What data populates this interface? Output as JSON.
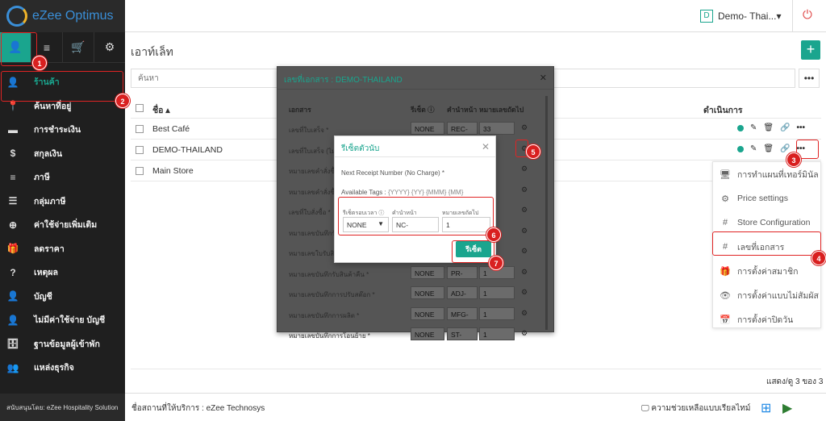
{
  "app": {
    "logo_text": "eZee Optimus"
  },
  "sidebar": {
    "tabs": [
      {
        "icon": "user-icon",
        "glyph": "👤"
      },
      {
        "icon": "menu-icon",
        "glyph": "≡"
      },
      {
        "icon": "cart-icon",
        "glyph": "🛒"
      },
      {
        "icon": "gear-icon",
        "glyph": "⚙"
      }
    ],
    "items": [
      {
        "label": "ร้านค้า",
        "glyph": "👤"
      },
      {
        "label": "ค้นหาที่อยู่",
        "glyph": "📍"
      },
      {
        "label": "การชำระเงิน",
        "glyph": "▬"
      },
      {
        "label": "สกุลเงิน",
        "glyph": "$"
      },
      {
        "label": "ภาษี",
        "glyph": "≡"
      },
      {
        "label": "กลุ่มภาษี",
        "glyph": "☰"
      },
      {
        "label": "ค่าใช้จ่ายเพิ่มเติม",
        "glyph": "⊕"
      },
      {
        "label": "ลดราคา",
        "glyph": "🎁"
      },
      {
        "label": "เหตุผล",
        "glyph": "?"
      },
      {
        "label": "บัญชี",
        "glyph": "👤"
      },
      {
        "label": "ไม่มีค่าใช้จ่าย บัญชี",
        "glyph": "👤"
      },
      {
        "label": "ฐานข้อมูลผู้เข้าพัก",
        "glyph": "🗄"
      },
      {
        "label": "แหล่งธุรกิจ",
        "glyph": "👥"
      }
    ],
    "footer": "สนับสนุนโดย: eZee Hospitality Solution"
  },
  "header": {
    "property_badge": "D",
    "property_name": "Demo- Thai...▾"
  },
  "page": {
    "title": "เอาท์เล็ท",
    "add_label": "+",
    "search_placeholder": "ค้นหา",
    "more_label": "•••",
    "table": {
      "col_name": "ชื่อ ▴",
      "col_actions": "ดำเนินการ",
      "rows": [
        "Best Café",
        "DEMO-THAILAND",
        "Main Store"
      ]
    },
    "pager": "แสดง/ดู 3 ของ 3"
  },
  "menu": {
    "items": [
      {
        "label": "การทำแผนที่เทอร์มินัล",
        "glyph": "🖥"
      },
      {
        "label": "Price settings",
        "glyph": "⚙"
      },
      {
        "label": "Store Configuration",
        "glyph": "#"
      },
      {
        "label": "เลขที่เอกสาร",
        "glyph": "#"
      },
      {
        "label": "การตั้งค่าสมาชิก",
        "glyph": "🎁"
      },
      {
        "label": "การตั้งค่าแบบไม่สัมผัส",
        "glyph": "👁"
      },
      {
        "label": "การตั้งค่าปิดวัน",
        "glyph": "📅"
      }
    ]
  },
  "doc_modal": {
    "title": "เลขที่เอกสาร : DEMO-THAILAND",
    "close": "✕",
    "col_doc": "เอกสาร",
    "col_reset": "รีเซ็ต ⓘ",
    "col_prefix": "คำนำหน้า",
    "col_next": "หมายเลขถัดไป",
    "rows": [
      {
        "label": "เลขที่ใบเสร็จ *",
        "reset": "NONE",
        "prefix": "REC-",
        "next": "33"
      },
      {
        "label": "เลขที่ใบเสร็จ (ไม่...",
        "reset": "",
        "prefix": "",
        "next": ""
      },
      {
        "label": "หมายเลขคำสั่งซื้...",
        "reset": "",
        "prefix": "",
        "next": ""
      },
      {
        "label": "หมายเลขคำสั่งซื้...",
        "reset": "",
        "prefix": "",
        "next": ""
      },
      {
        "label": "เลขที่ใบสั่งซื้อ *",
        "reset": "",
        "prefix": "",
        "next": ""
      },
      {
        "label": "หมายเลขบันทึกรับ...",
        "reset": "",
        "prefix": "",
        "next": ""
      },
      {
        "label": "หมายเลขใบรับสิน...",
        "reset": "",
        "prefix": "",
        "next": ""
      },
      {
        "label": "หมายเลขบันทึกรับสินค้าคืน *",
        "reset": "NONE",
        "prefix": "PR-",
        "next": "1"
      },
      {
        "label": "หมายเลขบันทึกการปรับสต๊อก *",
        "reset": "NONE",
        "prefix": "ADJ-",
        "next": "1"
      },
      {
        "label": "หมายเลขบันทึกการผลิต *",
        "reset": "NONE",
        "prefix": "MFG-",
        "next": "1"
      },
      {
        "label": "หมายเลขบันทึกการโอนย้าย *",
        "reset": "NONE",
        "prefix": "ST-",
        "next": "1"
      }
    ]
  },
  "reset_dialog": {
    "title": "รีเซ็ตตัวนับ",
    "close": "✕",
    "field_label": "Next Receipt Number (No Charge) *",
    "tags_label": "Available Tags :",
    "tags_values": "{YYYY} {YY} {MMM} {MM}",
    "reset_label": "รีเซ็ตรอบเวลา ⓘ",
    "prefix_label": "คำนำหน้า",
    "next_label": "หมายเลขถัดไป",
    "reset_value": "NONE",
    "prefix_value": "NC-",
    "next_value": "1",
    "save_label": "รีเซ็ต"
  },
  "footer": {
    "left": "ชื่อสถานที่ให้บริการ : eZee Technosys",
    "help": "🖵 ความช่วยเหลือแบบเรียลไทม์"
  },
  "annotations": [
    "1",
    "2",
    "3",
    "4",
    "5",
    "6",
    "7"
  ],
  "colors": {
    "accent": "#1aa58e",
    "annotation_red": "#e02424",
    "sidebar_bg": "#1f1f1f"
  }
}
